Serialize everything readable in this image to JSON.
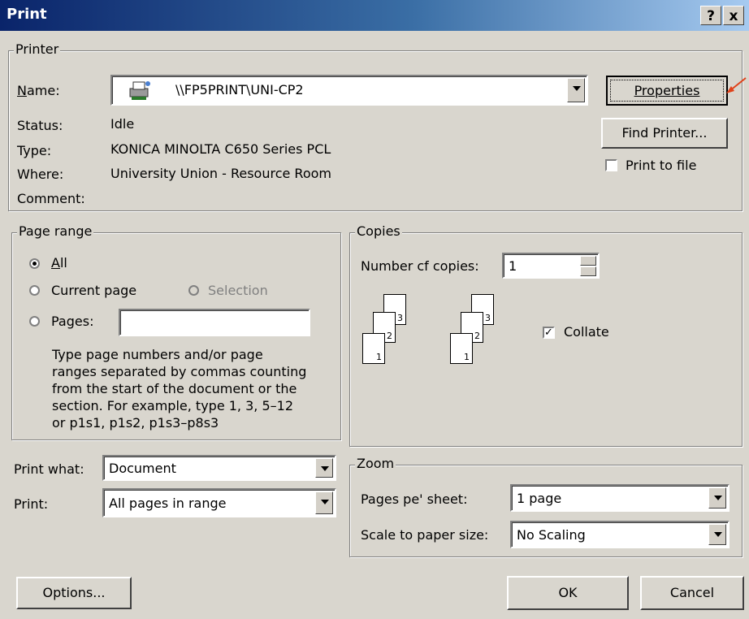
{
  "window": {
    "title": "Print"
  },
  "title_buttons": {
    "help": "?",
    "close": "x"
  },
  "printer": {
    "group_label": "Printer",
    "name_label": "Name:",
    "name_value": "\\\\FP5PRINT\\UNI-CP2",
    "status_label": "Status:",
    "status_value": "Idle",
    "type_label": "Type:",
    "type_value": "KONICA MINOLTA C650 Series PCL",
    "where_label": "Where:",
    "where_value": "University Union - Resource Room",
    "comment_label": "Comment:",
    "comment_value": "",
    "properties_button": "Properties",
    "find_printer_button": "Find Printer...",
    "print_to_file_label": "Print to file",
    "print_to_file_checked": false
  },
  "page_range": {
    "group_label": "Page range",
    "all_label": "All",
    "current_page_label": "Current page",
    "selection_label": "Selection",
    "pages_label": "Pages:",
    "pages_value": "",
    "selected": "All",
    "help_text_lines": [
      "Type page numbers and/or page",
      "ranges separated by commas counting",
      "from the start of the document or the",
      "section. For example, type 1, 3, 5–12",
      "or p1s1, p1s2, p1s3–p8s3"
    ]
  },
  "copies": {
    "group_label": "Copies",
    "number_label": "Number cf copies:",
    "number_value": "1",
    "collate_label": "Collate",
    "collate_checked": true,
    "page_numbers": [
      "1",
      "2",
      "3"
    ]
  },
  "print_what": {
    "label": "Print what:",
    "value": "Document"
  },
  "print": {
    "label": "Print:",
    "value": "All pages in range"
  },
  "zoom": {
    "group_label": "Zoom",
    "pages_per_sheet_label": "Pages pe' sheet:",
    "pages_per_sheet_value": "1 page",
    "scale_label": "Scale to paper size:",
    "scale_value": "No Scaling"
  },
  "buttons": {
    "options": "Options...",
    "ok": "OK",
    "cancel": "Cancel"
  },
  "colors": {
    "title_bar_start": "#0a246a",
    "title_bar_end": "#a6caf0",
    "annotation_arrow": "#e0421a",
    "dialog_bg": "#d9d6ce"
  }
}
